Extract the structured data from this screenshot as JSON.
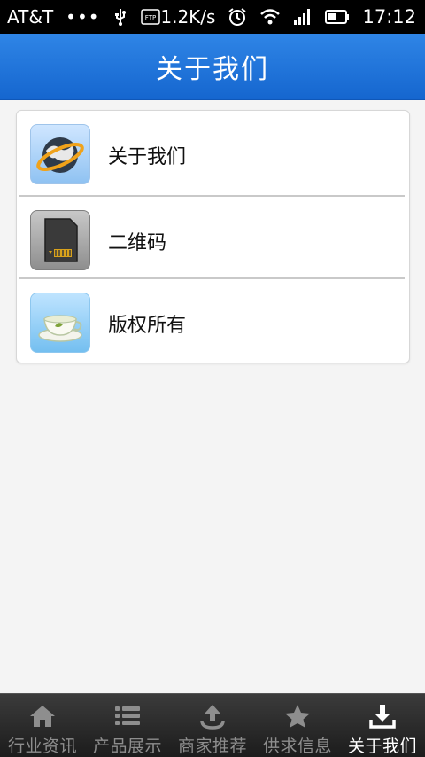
{
  "status_bar": {
    "carrier": "AT&T",
    "dots": "•••",
    "speed": "1.2K/s",
    "time": "17:12",
    "icons": [
      "usb-icon",
      "ftp-icon",
      "alarm-icon",
      "wifi-icon",
      "signal-icon",
      "battery-icon"
    ]
  },
  "header": {
    "title": "关于我们"
  },
  "menu": {
    "items": [
      {
        "label": "关于我们",
        "icon": "globe-icon"
      },
      {
        "label": "二维码",
        "icon": "sd-card-icon"
      },
      {
        "label": "版权所有",
        "icon": "teacup-icon"
      }
    ]
  },
  "bottom_nav": {
    "items": [
      {
        "label": "行业资讯",
        "icon": "home-icon",
        "active": false
      },
      {
        "label": "产品展示",
        "icon": "list-icon",
        "active": false
      },
      {
        "label": "商家推荐",
        "icon": "upload-icon",
        "active": false
      },
      {
        "label": "供求信息",
        "icon": "star-icon",
        "active": false
      },
      {
        "label": "关于我们",
        "icon": "download-icon",
        "active": true
      }
    ]
  }
}
